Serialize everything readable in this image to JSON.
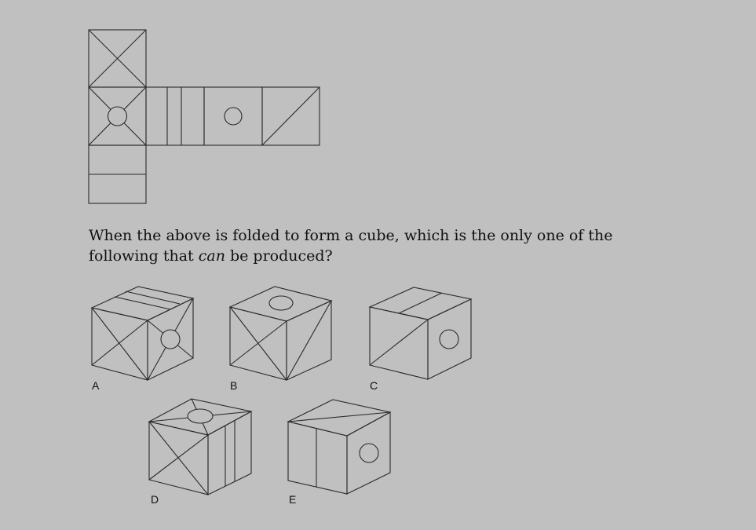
{
  "question": {
    "part1": "When the above is folded to form a cube, which is the only one of the following that ",
    "emphasis": "can",
    "part2": " be produced?"
  },
  "options": [
    {
      "id": "a",
      "label": "A"
    },
    {
      "id": "b",
      "label": "B"
    },
    {
      "id": "c",
      "label": "C"
    },
    {
      "id": "d",
      "label": "D"
    },
    {
      "id": "e",
      "label": "E"
    }
  ]
}
